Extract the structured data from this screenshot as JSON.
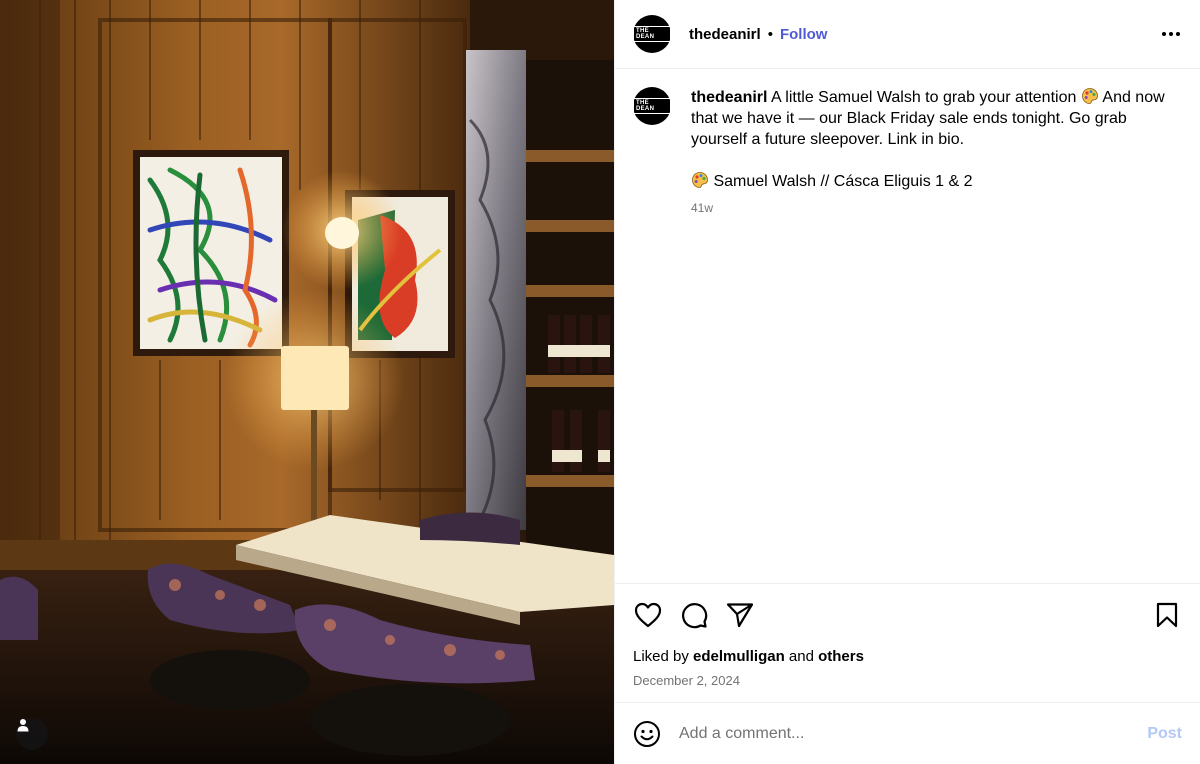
{
  "post": {
    "account": {
      "username": "thedeanirl",
      "avatar_text": "THE DEAN",
      "follow_label": "Follow",
      "separator": "•"
    },
    "caption": {
      "username": "thedeanirl",
      "text_before_emoji": " A little Samuel Walsh to grab your attention ",
      "text_after_emoji": " And now that we have it — our Black Friday sale ends tonight. Go grab yourself a future sleepover. Link in bio.",
      "credit": " Samuel Walsh // Cásca Eliguis 1 & 2",
      "emoji_name": "artist-palette-icon",
      "age": "41w"
    },
    "likes": {
      "prefix": "Liked by ",
      "user": "edelmulligan",
      "middle": " and ",
      "others": "others"
    },
    "date": "December 2, 2024",
    "comment": {
      "placeholder": "Add a comment...",
      "post_label": "Post"
    }
  },
  "actions": {
    "icons": [
      "heart-icon",
      "comment-icon",
      "share-icon",
      "bookmark-icon"
    ]
  },
  "colors": {
    "follow": "#4f5bd5",
    "post_disabled": "#b3c9f5",
    "muted": "#737373",
    "divider": "#efefef"
  }
}
